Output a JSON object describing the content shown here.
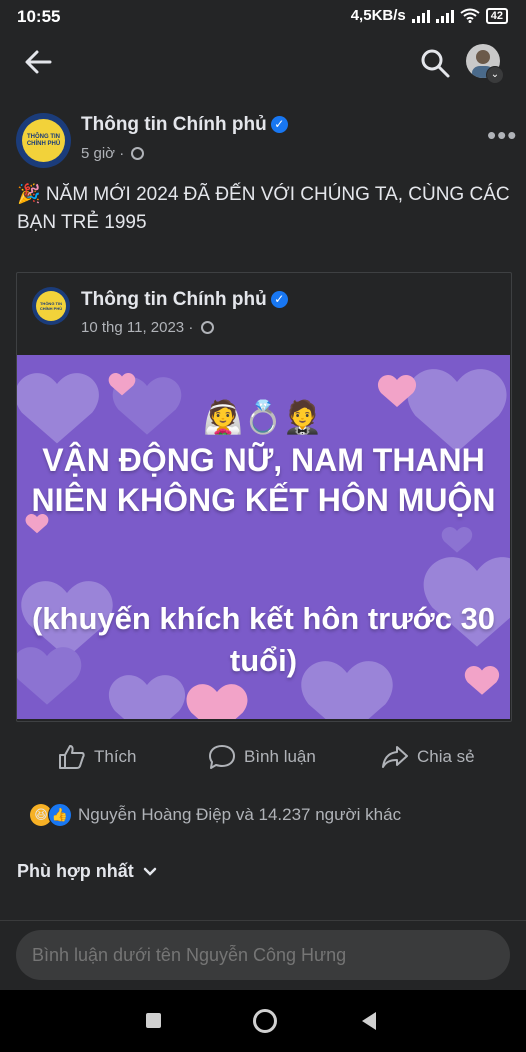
{
  "status_bar": {
    "time": "10:55",
    "network_speed": "4,5KB/s",
    "battery": "42"
  },
  "post": {
    "page_name": "Thông tin Chính phủ",
    "time": "5 giờ",
    "text": "🎉 NĂM MỚI 2024 ĐÃ ĐẾN VỚI CHÚNG TA, CÙNG CÁC BẠN TRẺ 1995"
  },
  "shared_post": {
    "page_name": "Thông tin Chính phủ",
    "time": "10 thg 11, 2023",
    "emojis": "👰💍🤵",
    "banner_title": "VẬN ĐỘNG NỮ, NAM THANH NIÊN KHÔNG KẾT HÔN MUỘN",
    "banner_subtitle": "(khuyến khích kết hôn trước 30 tuổi)"
  },
  "actions": {
    "like": "Thích",
    "comment": "Bình luận",
    "share": "Chia sẻ"
  },
  "reactions": {
    "summary": "Nguyễn Hoàng Điệp và 14.237 người khác"
  },
  "sort": {
    "label": "Phù hợp nhất"
  },
  "comment_box": {
    "placeholder": "Bình luận dưới tên Nguyễn Công Hưng"
  },
  "colors": {
    "background": "#242526",
    "banner": "#7b5bc9",
    "verified": "#1877f2"
  }
}
